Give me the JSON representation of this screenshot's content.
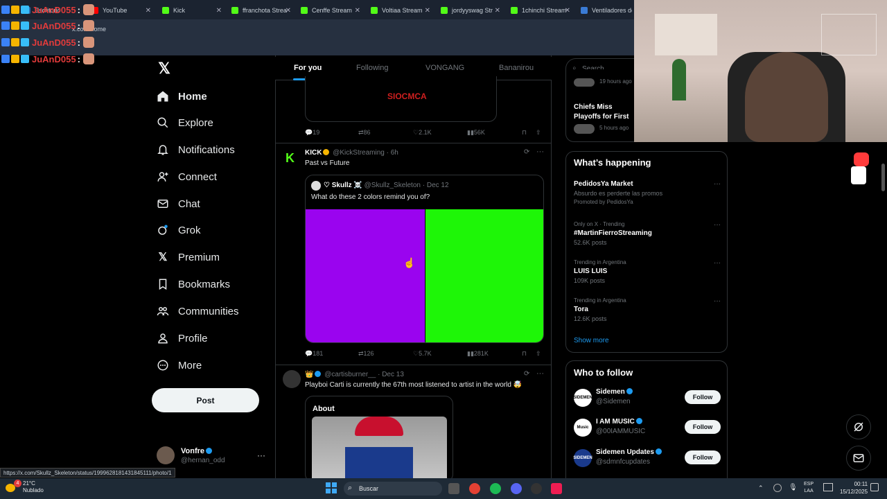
{
  "browser": {
    "tabs": [
      {
        "label": "Escritorio",
        "fav": "#2b6cb0"
      },
      {
        "label": "YouTube",
        "fav": "#ff0000"
      },
      {
        "label": "Kick",
        "fav": "#53fc18"
      },
      {
        "label": "ffranchota Strea",
        "fav": "#53fc18"
      },
      {
        "label": "Cenffe Stream",
        "fav": "#53fc18"
      },
      {
        "label": "Voltiaa Stream",
        "fav": "#53fc18"
      },
      {
        "label": "jordyyswag Str",
        "fav": "#53fc18"
      },
      {
        "label": "1chinchi Stream",
        "fav": "#53fc18"
      },
      {
        "label": "Ventiladores de",
        "fav": "#3a7bd5"
      }
    ],
    "url": "x.com/home"
  },
  "chat_overlay": {
    "lines": [
      {
        "name": "JuAnD055",
        "colon": ":"
      },
      {
        "name": "JuAnD055",
        "colon": ":"
      },
      {
        "name": "JuAnD055",
        "colon": ":"
      },
      {
        "name": "JuAnD055",
        "colon": ":"
      }
    ]
  },
  "nav": {
    "items": [
      {
        "label": "Home",
        "icon": "home-icon"
      },
      {
        "label": "Explore",
        "icon": "search-icon"
      },
      {
        "label": "Notifications",
        "icon": "bell-icon"
      },
      {
        "label": "Connect",
        "icon": "add-user-icon"
      },
      {
        "label": "Chat",
        "icon": "mail-icon"
      },
      {
        "label": "Grok",
        "icon": "grok-icon"
      },
      {
        "label": "Premium",
        "icon": "x-logo-icon"
      },
      {
        "label": "Bookmarks",
        "icon": "bookmark-icon"
      },
      {
        "label": "Communities",
        "icon": "people-icon"
      },
      {
        "label": "Profile",
        "icon": "person-icon"
      },
      {
        "label": "More",
        "icon": "more-icon"
      }
    ],
    "post_label": "Post",
    "account": {
      "name": "Vonfre",
      "handle": "@hernan_odd",
      "dots": "···"
    }
  },
  "feed": {
    "tabs": [
      "For you",
      "Following",
      "VONGANG",
      "Bananirou"
    ],
    "post0": {
      "card_text": "SIOCMCA",
      "replies": "19",
      "reposts": "86",
      "likes": "2.1K",
      "views": "56K"
    },
    "post1": {
      "name": "KICK",
      "handle": "@KickStreaming",
      "time": "· 6h",
      "text": "Past vs Future",
      "quote": {
        "name": "♡ Skullz ☠️",
        "handle": "@Skullz_Skeleton",
        "date": "· Dec 12",
        "text": "What do these 2 colors remind you of?",
        "colors": [
          "#9a04ef",
          "#1ef607"
        ]
      },
      "replies": "181",
      "reposts": "126",
      "likes": "5.7K",
      "views": "281K"
    },
    "post2": {
      "handle": "@cartisburner__",
      "date": "· Dec 13",
      "text": "Playboi Carti is currently the 67th most listened to artist in the world 🤯",
      "card_title": "About"
    }
  },
  "right": {
    "search_placeholder": "Search",
    "partial_news": {
      "time1": "19 hours ago",
      "title": "Chiefs Miss Playoffs for First Time in Decade in Loss to Chargers",
      "time2": "5 hours ago"
    },
    "happening": {
      "title": "What’s happening",
      "items": [
        {
          "meta": "",
          "title": "PedidosYa Market",
          "sub": "Absurdo es perderte las promos",
          "extra": "Promoted by PedidosYa"
        },
        {
          "meta": "Only on X · Trending",
          "title": "#MartinFierroStreaming",
          "sub": "52.6K posts",
          "extra": ""
        },
        {
          "meta": "Trending in Argentina",
          "title": "LUIS LUIS",
          "sub": "109K posts",
          "extra": ""
        },
        {
          "meta": "Trending in Argentina",
          "title": "Tora",
          "sub": "12.6K posts",
          "extra": ""
        }
      ],
      "show_more": "Show more"
    },
    "who_to_follow": {
      "title": "Who to follow",
      "users": [
        {
          "name": "Sidemen",
          "handle": "@Sidemen",
          "avatar": "SIDEMEN"
        },
        {
          "name": "I AM MUSIC",
          "handle": "@00IAMMUSIC",
          "avatar": "Music"
        },
        {
          "name": "Sidemen Updates",
          "handle": "@sdmnfcupdates",
          "avatar": "SIDEMEN"
        }
      ],
      "follow_label": "Follow"
    }
  },
  "status_url": "https://x.com/Skullz_Skeleton/status/1999628181431845111/photo/1",
  "taskbar": {
    "weather_temp": "21°C",
    "weather_desc": "Nublado",
    "search_label": "Buscar",
    "lang1": "ESP",
    "lang2": "LAA",
    "time": "00:11",
    "date": "15/12/2025",
    "notif_badge": "4"
  }
}
